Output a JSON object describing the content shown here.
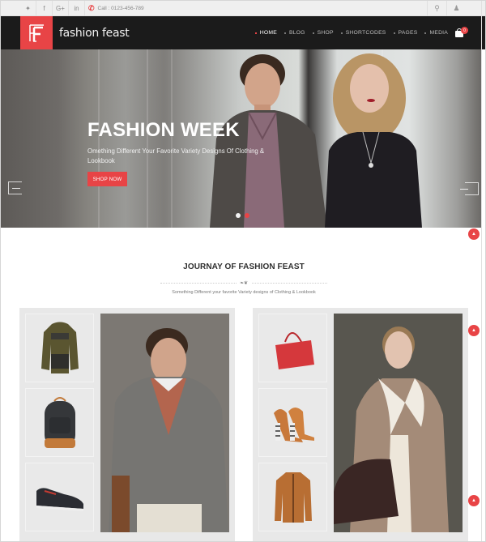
{
  "topbar": {
    "social": [
      {
        "icon": "twitter-icon",
        "glyph": "✦"
      },
      {
        "icon": "facebook-icon",
        "glyph": "f"
      },
      {
        "icon": "google-plus-icon",
        "glyph": "G+"
      },
      {
        "icon": "linkedin-icon",
        "glyph": "in"
      }
    ],
    "call_label": "Call : 0123-456-789",
    "search_glyph": "⚲",
    "account_glyph": "♟"
  },
  "header": {
    "brand": "fashion feast",
    "nav": [
      {
        "label": "HOME",
        "active": true
      },
      {
        "label": "BLOG",
        "active": false
      },
      {
        "label": "SHOP",
        "active": false
      },
      {
        "label": "SHORTCODES",
        "active": false
      },
      {
        "label": "PAGES",
        "active": false
      },
      {
        "label": "MEDIA",
        "active": false
      }
    ],
    "cart_count": "0"
  },
  "hero": {
    "title": "FASHION WEEK",
    "subtitle": "Omething Different Your Favorite Variety Designs Of Clothing & Lookbook",
    "button": "SHOP NOW",
    "slides": [
      {
        "active": false
      },
      {
        "active": true
      }
    ]
  },
  "section": {
    "title": "JOURNAY OF FASHION FEAST",
    "divider_glyph": "❧❦",
    "subtitle": "Something Different your favorite Variety designs of Clothing & Lookbook"
  },
  "lookbook": [
    {
      "name": "men",
      "thumbs": [
        "puffer-jacket",
        "backpack",
        "sneaker-shoe"
      ],
      "main": "man-in-blazer"
    },
    {
      "name": "women",
      "thumbs": [
        "red-handbag",
        "high-heel-shoes",
        "leather-jacket"
      ],
      "main": "woman-in-shearling-coat"
    }
  ],
  "colors": {
    "accent": "#e84446",
    "header_bg": "#1b1b1b",
    "topbar_bg": "#efefef",
    "dot_inactive": "#f2f2f2"
  }
}
